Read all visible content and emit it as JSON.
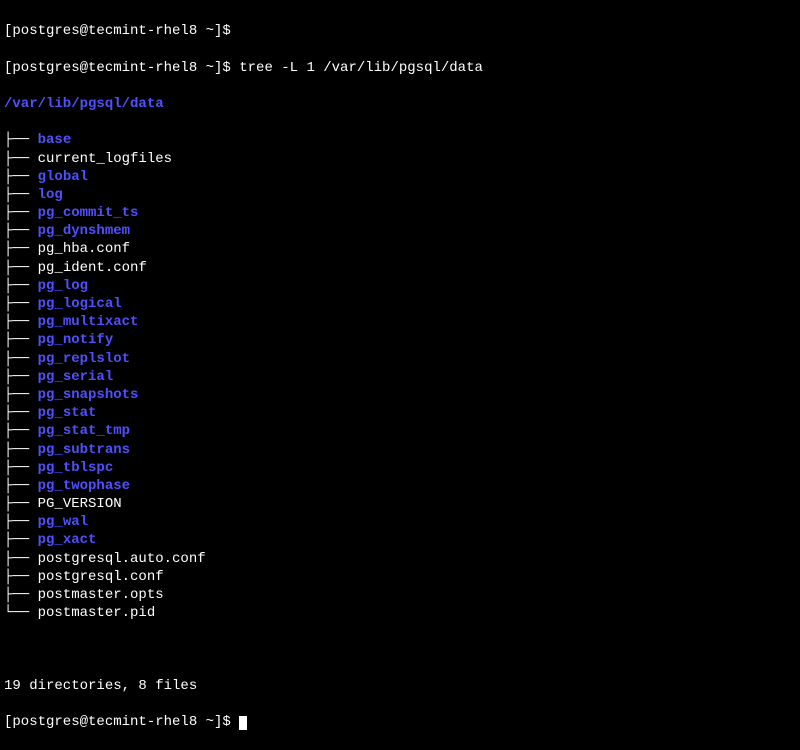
{
  "prompt1": "[postgres@tecmint-rhel8 ~]$",
  "prompt2": "[postgres@tecmint-rhel8 ~]$ tree -L 1 /var/lib/pgsql/data",
  "root_path": "/var/lib/pgsql/data",
  "entries": [
    {
      "name": "base",
      "type": "dir",
      "branch": "├── "
    },
    {
      "name": "current_logfiles",
      "type": "file",
      "branch": "├── "
    },
    {
      "name": "global",
      "type": "dir",
      "branch": "├── "
    },
    {
      "name": "log",
      "type": "dir",
      "branch": "├── "
    },
    {
      "name": "pg_commit_ts",
      "type": "dir",
      "branch": "├── "
    },
    {
      "name": "pg_dynshmem",
      "type": "dir",
      "branch": "├── "
    },
    {
      "name": "pg_hba.conf",
      "type": "file",
      "branch": "├── "
    },
    {
      "name": "pg_ident.conf",
      "type": "file",
      "branch": "├── "
    },
    {
      "name": "pg_log",
      "type": "dir",
      "branch": "├── "
    },
    {
      "name": "pg_logical",
      "type": "dir",
      "branch": "├── "
    },
    {
      "name": "pg_multixact",
      "type": "dir",
      "branch": "├── "
    },
    {
      "name": "pg_notify",
      "type": "dir",
      "branch": "├── "
    },
    {
      "name": "pg_replslot",
      "type": "dir",
      "branch": "├── "
    },
    {
      "name": "pg_serial",
      "type": "dir",
      "branch": "├── "
    },
    {
      "name": "pg_snapshots",
      "type": "dir",
      "branch": "├── "
    },
    {
      "name": "pg_stat",
      "type": "dir",
      "branch": "├── "
    },
    {
      "name": "pg_stat_tmp",
      "type": "dir",
      "branch": "├── "
    },
    {
      "name": "pg_subtrans",
      "type": "dir",
      "branch": "├── "
    },
    {
      "name": "pg_tblspc",
      "type": "dir",
      "branch": "├── "
    },
    {
      "name": "pg_twophase",
      "type": "dir",
      "branch": "├── "
    },
    {
      "name": "PG_VERSION",
      "type": "file",
      "branch": "├── "
    },
    {
      "name": "pg_wal",
      "type": "dir",
      "branch": "├── "
    },
    {
      "name": "pg_xact",
      "type": "dir",
      "branch": "├── "
    },
    {
      "name": "postgresql.auto.conf",
      "type": "file",
      "branch": "├── "
    },
    {
      "name": "postgresql.conf",
      "type": "file",
      "branch": "├── "
    },
    {
      "name": "postmaster.opts",
      "type": "file",
      "branch": "├── "
    },
    {
      "name": "postmaster.pid",
      "type": "file",
      "branch": "└── "
    }
  ],
  "summary": "19 directories, 8 files",
  "prompt3": "[postgres@tecmint-rhel8 ~]$ "
}
